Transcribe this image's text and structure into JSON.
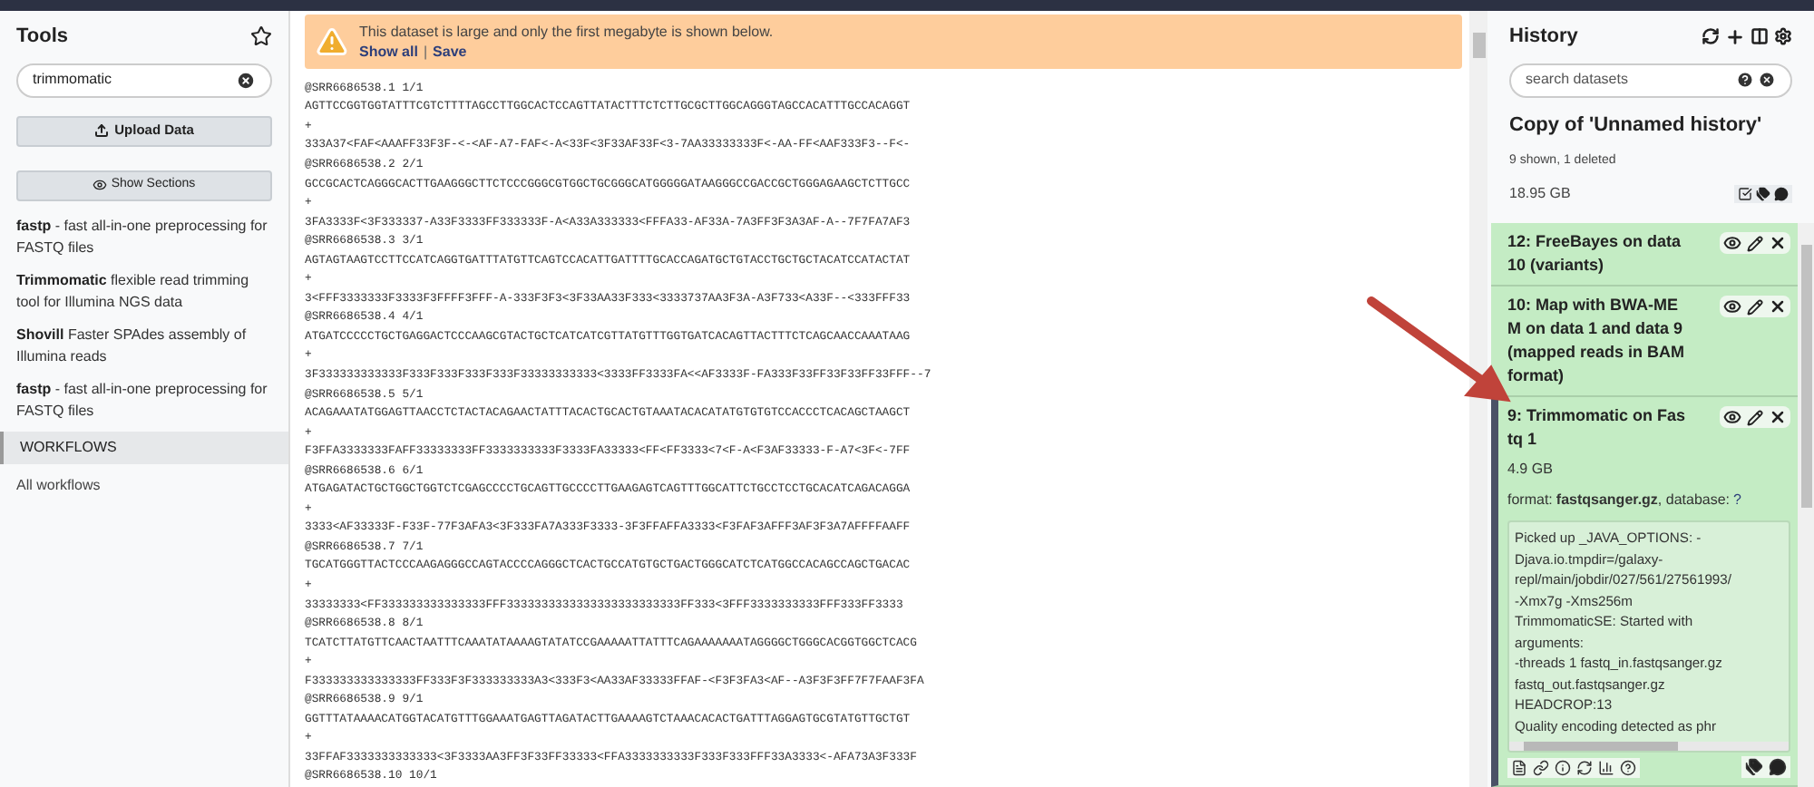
{
  "tools": {
    "title": "Tools",
    "search": {
      "value": "trimmomatic"
    },
    "upload_button": "Upload Data",
    "sections_button": "Show Sections",
    "results": [
      {
        "name": "fastp",
        "description": " - fast all-in-one preprocessing for FASTQ files"
      },
      {
        "name": "Trimmomatic",
        "description": " flexible read trimming tool for Illumina NGS data"
      },
      {
        "name": "Shovill",
        "description": " Faster SPAdes assembly of Illumina reads"
      },
      {
        "name": "fastp",
        "description": " - fast all-in-one preprocessing for FASTQ files"
      }
    ],
    "section": "WORKFLOWS",
    "link": "All workflows"
  },
  "dataset": {
    "warning": {
      "message": "This dataset is large and only the first megabyte is shown below.",
      "links": [
        "Show all",
        "Save"
      ],
      "separator": "|"
    },
    "lines": [
      "@SRR6686538.1 1/1",
      "AGTTCCGGTGGTATTTCGTCTTTTAGCCTTGGCACTCCAGTTATACTTTCTCTTGCGCTTGGCAGGGTAGCCACATTTGCCACAGGT",
      "+",
      "333A37<FAF<AAAFF33F3F-<-<AF-A7-FAF<-A<33F<3F33AF33F<3-7AA33333333F<-AA-FF<AAF333F3--F<-",
      "@SRR6686538.2 2/1",
      "GCCGCACTCAGGGCACTTGAAGGGCTTCTCCCGGGCGTGGCTGCGGGCATGGGGGATAAGGGCCGACCGCTGGGAGAAGCTCTTGCC",
      "+",
      "3FA3333F<3F333337-A33F3333FF333333F-A<A33A333333<FFFA33-AF33A-7A3FF3F3A3AF-A--7F7FA7AF3",
      "@SRR6686538.3 3/1",
      "AGTAGTAAGTCCTTCCATCAGGTGATTTATGTTCAGTCCACATTGATTTTGCACCAGATGCTGTACCTGCTGCTACATCCATACTAT",
      "+",
      "3<FFF3333333F3333F3FFFF3FFF-A-333F3F3<3F33AA33F333<3333737AA3F3A-A3F733<A33F--<333FFF33",
      "@SRR6686538.4 4/1",
      "ATGATCCCCCTGCTGAGGACTCCCAAGCGTACTGCTCATCATCGTTATGTTTGGTGATCACAGTTACTTTCTCAGCAACCAAATAAG",
      "+",
      "3F333333333333F333F333F333F333F33333333333<3333FF3333FA<<AF3333F-FA333F33FF33F33FF33FFF--7",
      "@SRR6686538.5 5/1",
      "ACAGAAATATGGAGTTAACCTCTACTACAGAACTATTTACACTGCACTGTAAATACACATATGTGTGTCCACCCTCACAGCTAAGCT",
      "+",
      "F3FFA3333333FAFF33333333FF3333333333F3333FA33333<FF<FF3333<7<F-A<F3AF33333-F-A7<3F<-7FF",
      "@SRR6686538.6 6/1",
      "ATGAGATACTGCTGGCTGGTCTCGAGCCCCTGCAGTTGCCCCTTGAAGAGTCAGTTTGGCATTCTGCCTCCTGCACATCAGACAGGA",
      "+",
      "3333<AF33333F-F33F-77F3AFA3<3F333FA7A333F3333-3F3FFAFFA3333<F3FAF3AFFF3AF3F3A7AFFFFAAFF",
      "@SRR6686538.7 7/1",
      "TGCATGGGTTACTCCCAAGAGGGCCAGTACCCCAGGGCTCACTGCCATGTGCTGACTGGGCATCTCATGGCCACAGCCAGCTGACAC",
      "+",
      "33333333<FF333333333333333FFF3333333333333333333333333FF333<3FFF3333333333FFF333FF3333",
      "@SRR6686538.8 8/1",
      "TCATCTTATGTTCAACTAATTTCAAATATAAAAGTATATCCGAAAAATTATTTCAGAAAAAAATAGGGGCTGGGCACGGTGGCTCACG",
      "+",
      "F333333333333333FF333F3F333333333A3<333F3<AA33AF33333FFAF-<F3F3FA3<AF--A3F3F3FF7F7FAAF3FA",
      "@SRR6686538.9 9/1",
      "GGTTTATAAAACATGGTACATGTTTGGAAATGAGTTAGATACTTGAAAAGTCTAAACACACTGATTTAGGAGTGCGTATGTTGCTGT",
      "+",
      "33FFAF3333333333333<3F3333AA3FF3F33FF33333<FFA3333333333F333F333FFF33A3333<-AFA73A3F333F",
      "@SRR6686538.10 10/1"
    ]
  },
  "history": {
    "title": "History",
    "search": {
      "placeholder": "search datasets"
    },
    "name": "Copy of 'Unnamed history'",
    "summary": "9 shown, 1 deleted",
    "size": "18.95 GB",
    "items": [
      {
        "title": "12: FreeBayes on data 10 (variants)",
        "expanded": false
      },
      {
        "title": "10: Map with BWA-MEM on data 1 and data 9 (mapped reads in BAM format)",
        "expanded": false
      },
      {
        "title": "9: Trimmomatic on Fastq 1",
        "expanded": true,
        "size": "4.9 GB",
        "format_label": "format:",
        "format": "fastqsanger.gz",
        "database_label": ", database:",
        "database": "?",
        "info": [
          "Picked up _JAVA_OPTIONS: -",
          "Djava.io.tmpdir=/galaxy-",
          "repl/main/jobdir/027/561/27561993/",
          "-Xmx7g -Xms256m",
          "TrimmomaticSE: Started with",
          "arguments:",
          "-threads 1 fastq_in.fastqsanger.gz",
          "fastq_out.fastqsanger.gz",
          "HEADCROP:13",
          "Quality encoding detected as phr"
        ]
      }
    ]
  }
}
